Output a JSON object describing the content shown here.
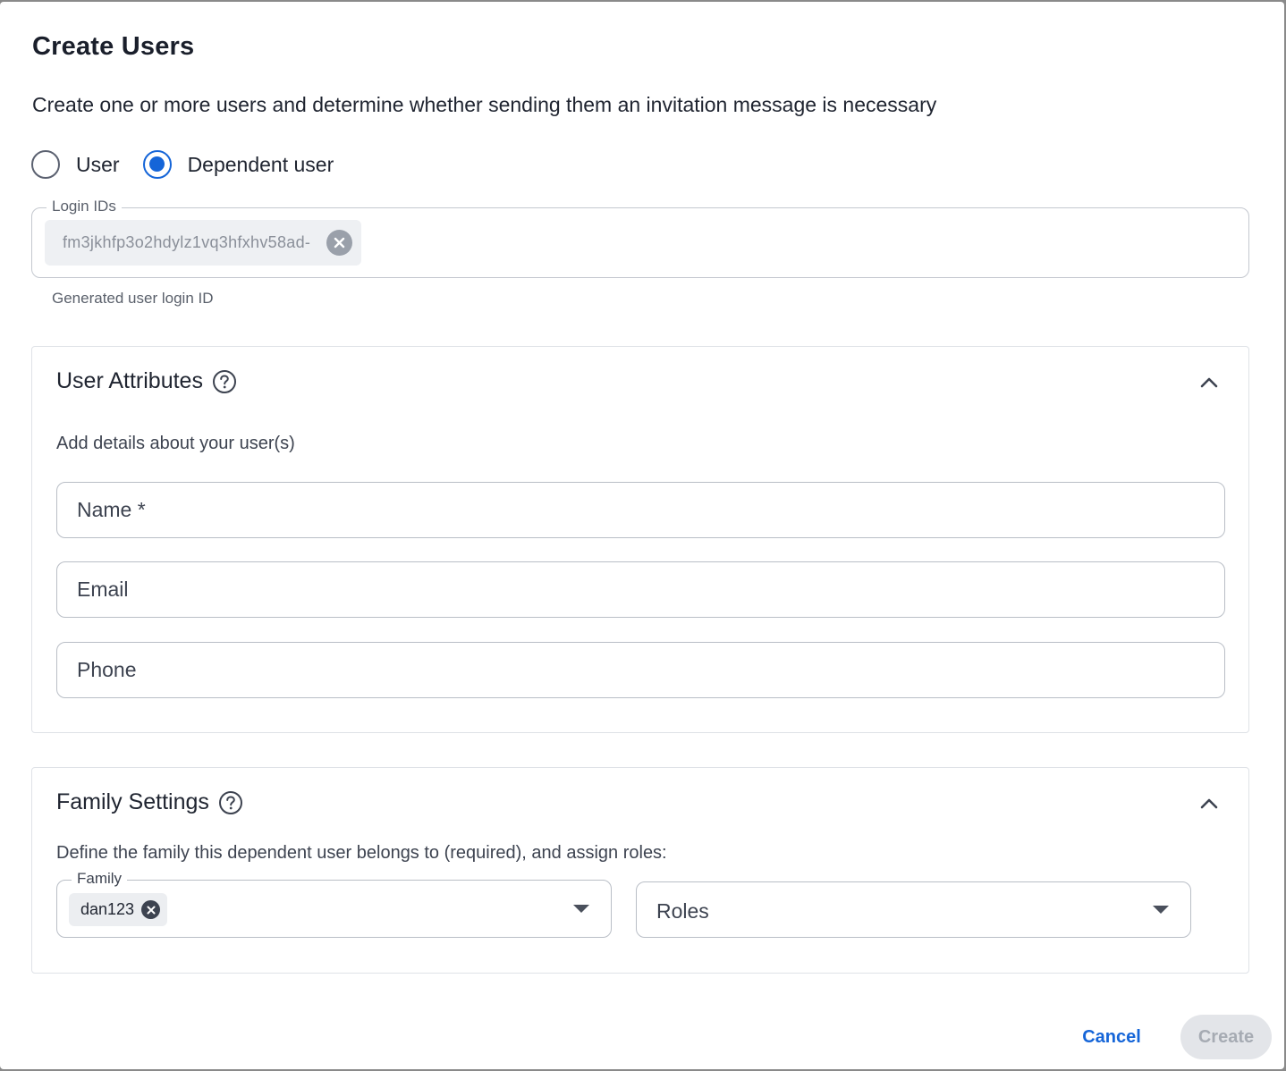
{
  "dialog": {
    "title": "Create Users",
    "subtitle": "Create one or more users and determine whether sending them an invitation message is necessary"
  },
  "user_type": {
    "options": [
      {
        "label": "User",
        "checked": false
      },
      {
        "label": "Dependent user",
        "checked": true
      }
    ]
  },
  "login_ids": {
    "label": "Login IDs",
    "chips": [
      "fm3jkhfp3o2hdylz1vq3hfxhv58ad-"
    ],
    "helper": "Generated user login ID"
  },
  "user_attributes": {
    "title": "User Attributes",
    "description": "Add details about your user(s)",
    "fields": {
      "name_placeholder": "Name *",
      "email_placeholder": "Email",
      "phone_placeholder": "Phone"
    },
    "expanded": true
  },
  "family_settings": {
    "title": "Family Settings",
    "description": "Define the family this dependent user belongs to (required), and assign roles:",
    "family": {
      "label": "Family",
      "chips": [
        "dan123"
      ]
    },
    "roles": {
      "placeholder": "Roles"
    },
    "expanded": true
  },
  "actions": {
    "cancel_label": "Cancel",
    "create_label": "Create",
    "create_disabled": true
  },
  "colors": {
    "accent": "#1565d8",
    "disabled_bg": "#e3e5e9",
    "text": "#1f2430"
  },
  "icons": [
    "close-circle-icon",
    "help-circle-icon",
    "chevron-up-icon",
    "caret-down-icon"
  ]
}
